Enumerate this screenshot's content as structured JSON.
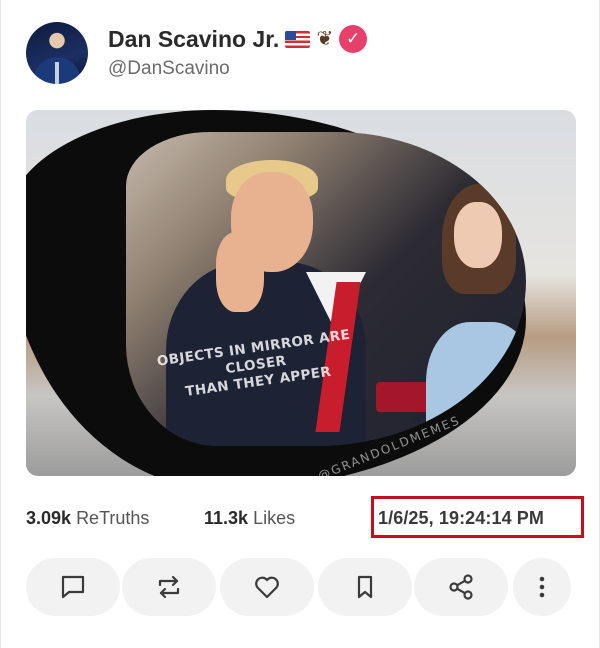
{
  "post": {
    "author": {
      "display_name": "Dan Scavino Jr.",
      "emoji_flag": "us-flag-icon",
      "emoji_eagle": "eagle-icon",
      "verified_icon": "verified-badge-icon",
      "handle": "@DanScavino"
    },
    "media": {
      "mirror_text_line1": "OBJECTS IN MIRROR ARE CLOSER",
      "mirror_text_line2": "THAN THEY APPER",
      "watermark": "@GRANDOLDMEMES"
    },
    "stats": {
      "retruths_count": "3.09k",
      "retruths_label": "ReTruths",
      "likes_count": "11.3k",
      "likes_label": "Likes",
      "timestamp": "1/6/25, 19:24:14 PM"
    },
    "actions": [
      "reply-icon",
      "retruth-icon",
      "like-icon",
      "bookmark-icon",
      "share-icon",
      "more-icon"
    ]
  },
  "colors": {
    "verified": "#e7406a",
    "highlight_box": "#c4101d",
    "action_bg": "#f2f2f2"
  }
}
